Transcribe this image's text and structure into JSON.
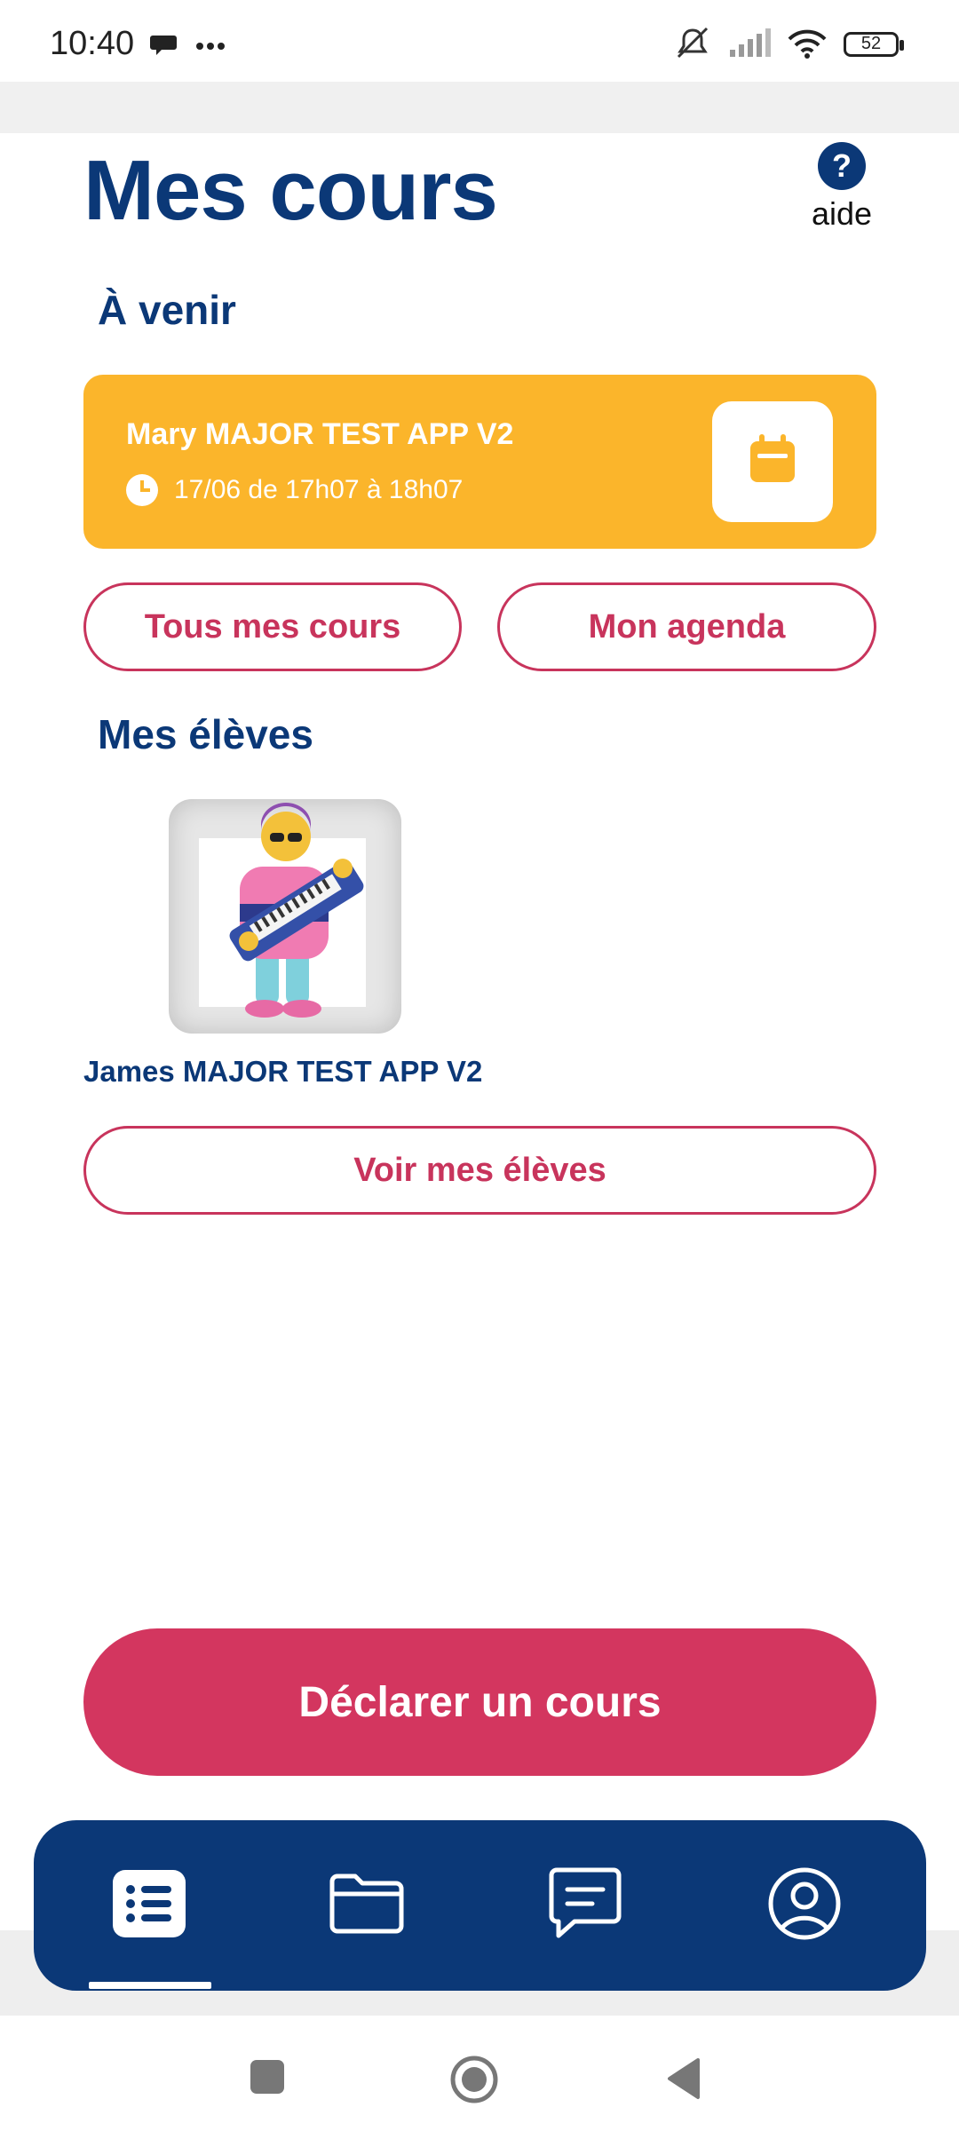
{
  "status_bar": {
    "time": "10:40",
    "battery": "52"
  },
  "header": {
    "title": "Mes cours",
    "help_label": "aide",
    "help_glyph": "?"
  },
  "upcoming": {
    "section_title": "À venir",
    "card": {
      "name": "Mary MAJOR TEST APP V2",
      "time": "17/06 de 17h07 à 18h07"
    }
  },
  "buttons": {
    "all_courses": "Tous mes cours",
    "agenda": "Mon agenda",
    "see_students": "Voir mes élèves",
    "declare_course": "Déclarer un cours"
  },
  "students": {
    "section_title": "Mes élèves",
    "items": [
      {
        "name": "James MAJOR TEST APP V2"
      }
    ]
  },
  "bottom_nav": {
    "items": [
      {
        "icon": "list-icon",
        "active": true
      },
      {
        "icon": "folder-icon",
        "active": false
      },
      {
        "icon": "chat-icon",
        "active": false
      },
      {
        "icon": "profile-icon",
        "active": false
      }
    ]
  },
  "colors": {
    "primary_blue": "#0b3877",
    "accent_pink": "#d3365f",
    "card_yellow": "#fbb52b"
  }
}
